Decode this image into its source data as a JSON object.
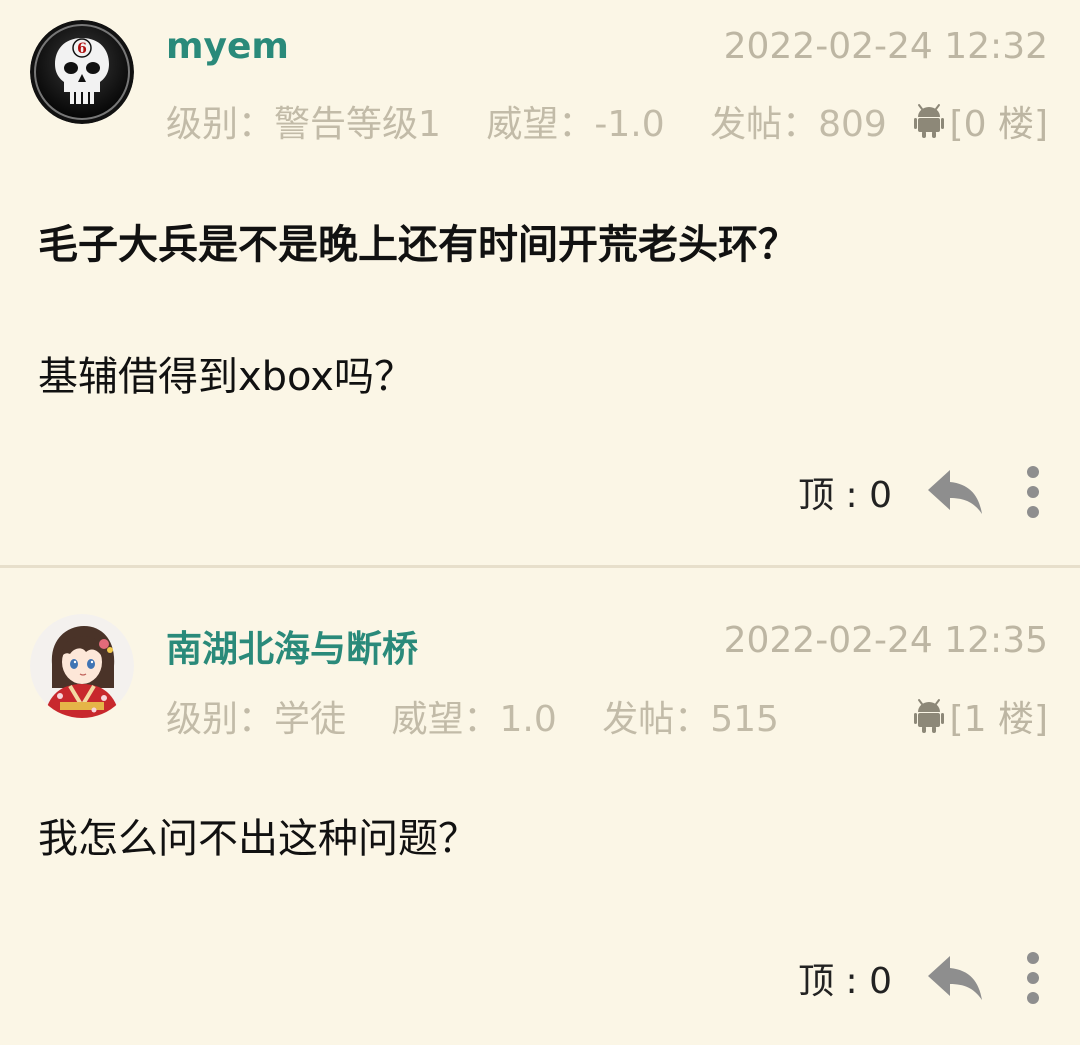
{
  "posts": [
    {
      "username": "myem",
      "timestamp": "2022-02-24 12:32",
      "level": "级别：警告等级1",
      "prestige": "威望：-1.0",
      "posts_count": "发帖：809",
      "floor": "[0 楼]",
      "title": "毛子大兵是不是晚上还有时间开荒老头环？",
      "body": "基辅借得到xbox吗？",
      "up_label": "顶 : 0",
      "avatar_icon": "skull-avatar-icon"
    },
    {
      "username": "南湖北海与断桥",
      "timestamp": "2022-02-24 12:35",
      "level": "级别：学徒",
      "prestige": "威望：1.0",
      "posts_count": "发帖：515",
      "floor": "[1 楼]",
      "body": "我怎么问不出这种问题？",
      "up_label": "顶 : 0",
      "avatar_icon": "anime-girl-avatar-icon"
    }
  ],
  "colors": {
    "background": "#fbf6e6",
    "username": "#2a8a7a",
    "meta": "#c2bba8",
    "icon": "#888888"
  }
}
